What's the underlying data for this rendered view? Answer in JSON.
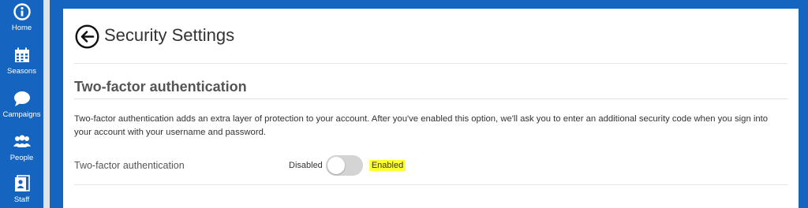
{
  "sidebar": {
    "items": [
      {
        "label": "Home",
        "icon": "home-icon"
      },
      {
        "label": "Seasons",
        "icon": "calendar-icon"
      },
      {
        "label": "Campaigns",
        "icon": "chat-bubble-icon"
      },
      {
        "label": "People",
        "icon": "people-icon"
      },
      {
        "label": "Staff",
        "icon": "staff-icon"
      }
    ]
  },
  "page": {
    "title": "Security Settings"
  },
  "section": {
    "title": "Two-factor authentication",
    "description": "Two-factor authentication adds an extra layer of protection to your account. After you've enabled this option, we'll ask you to enter an additional security code when you sign into your account with your username and password.",
    "setting_label": "Two-factor authentication",
    "toggle": {
      "off_label": "Disabled",
      "on_label": "Enabled",
      "state": "off"
    }
  },
  "colors": {
    "brand": "#1565c0",
    "highlight": "#ffff33",
    "toggle_track": "#d4d4d4"
  }
}
